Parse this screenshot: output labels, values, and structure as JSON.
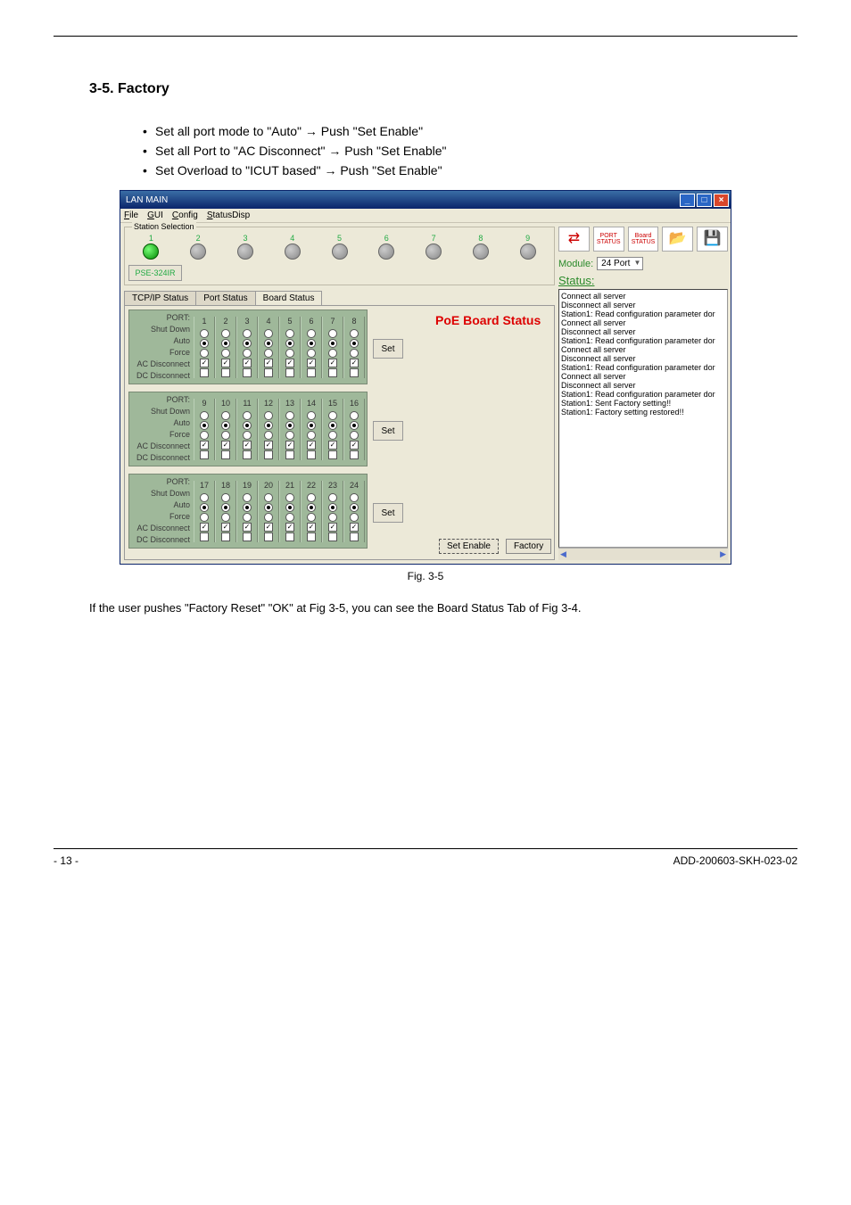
{
  "section_heading": "3-5. Factory",
  "bullets": [
    "Set all port mode to \"Auto\" → Push \"Set Enable\"",
    "Set all Port to \"AC Disconnect\" → Push \"Set Enable\"",
    "Set Overload to \"ICUT based\" → Push \"Set Enable\""
  ],
  "fig_caption": "Fig. 3-5",
  "below_text": "If the user pushes \"Factory Reset\" \"OK\" at Fig 3-5, you can see the Board Status Tab of Fig 3-4.",
  "footer_left": "- 13 -",
  "footer_right": "ADD-200603-SKH-023-02",
  "window": {
    "title": "LAN MAIN",
    "menus": [
      "File",
      "GUI",
      "Config",
      "StatusDisp"
    ],
    "station_legend": "Station Selection",
    "stations": [
      "1",
      "2",
      "3",
      "4",
      "5",
      "6",
      "7",
      "8",
      "9"
    ],
    "model": "PSE-324IR",
    "tabs": [
      "TCP/IP Status",
      "Port Status",
      "Board Status"
    ],
    "active_tab": 2,
    "row_labels": {
      "port": "PORT:",
      "shutdown": "Shut Down",
      "auto": "Auto",
      "force": "Force",
      "ac": "AC Disconnect",
      "dc": "DC Disconnect"
    },
    "set_label": "Set",
    "port_groups": [
      {
        "ports": [
          1,
          2,
          3,
          4,
          5,
          6,
          7,
          8
        ]
      },
      {
        "ports": [
          9,
          10,
          11,
          12,
          13,
          14,
          15,
          16
        ]
      },
      {
        "ports": [
          17,
          18,
          19,
          20,
          21,
          22,
          23,
          24
        ]
      }
    ],
    "poe_title": "PoE Board Status",
    "set_enable": "Set Enable",
    "factory": "Factory",
    "toolbar": {
      "port_status": "PORT STATUS",
      "board_status": "Board STATUS"
    },
    "module_label": "Module:",
    "module_value": "24 Port",
    "status_label": "Status:",
    "status_lines": [
      "Connect all server",
      "Disconnect all server",
      "Station1: Read configuration parameter dor",
      "Connect all server",
      "Disconnect all server",
      "Station1: Read configuration parameter dor",
      "Connect all server",
      "Disconnect all server",
      "Station1: Read configuration parameter dor",
      "Connect all server",
      "Disconnect all server",
      "Station1: Read configuration parameter dor",
      "Station1: Sent Factory setting!!",
      "Station1: Factory setting restored!!"
    ]
  }
}
